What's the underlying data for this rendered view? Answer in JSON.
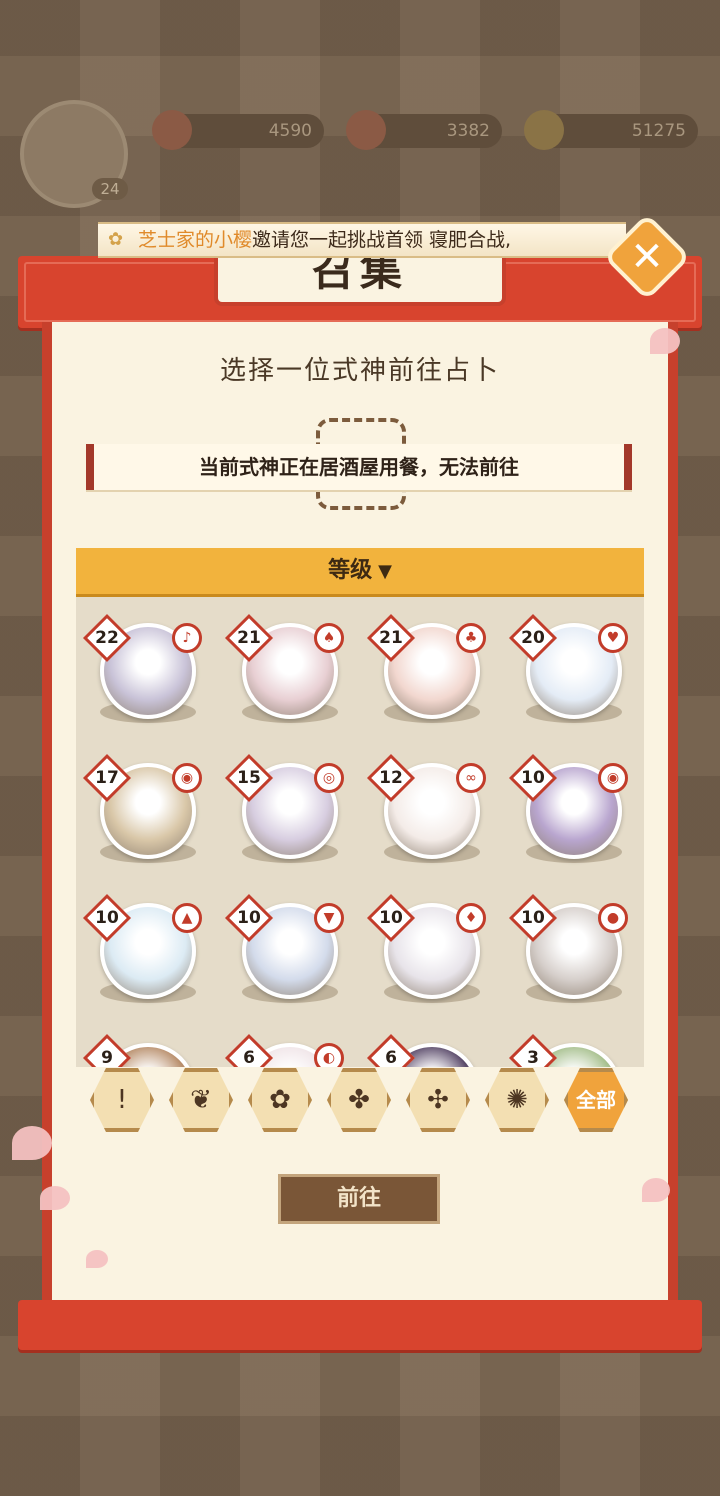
{
  "top": {
    "player_level": "24",
    "resources": [
      "4590",
      "3382",
      "51275"
    ]
  },
  "invite": {
    "inviter": "芝士家的小樱",
    "message": "邀请您一起挑战首领 寝肥合战,"
  },
  "dialog": {
    "title": "召集",
    "subtitle": "选择一位式神前往占卜",
    "notice": "当前式神正在居酒屋用餐，无法前往",
    "close_icon": "✕"
  },
  "sort": {
    "label": "等级",
    "chevron": "▼"
  },
  "shikigami": [
    {
      "level": "22",
      "badge": "♪",
      "color": "#c9c3d8"
    },
    {
      "level": "21",
      "badge": "♠",
      "color": "#e8cfd3"
    },
    {
      "level": "21",
      "badge": "♣",
      "color": "#f2d7cf"
    },
    {
      "level": "20",
      "badge": "♥",
      "color": "#e4ecf6"
    },
    {
      "level": "17",
      "badge": "◉",
      "color": "#d9c7a8"
    },
    {
      "level": "15",
      "badge": "◎",
      "color": "#d7cde0"
    },
    {
      "level": "12",
      "badge": "∞",
      "color": "#f4ece8"
    },
    {
      "level": "10",
      "badge": "◉",
      "color": "#b9a6cf"
    },
    {
      "level": "10",
      "badge": "▲",
      "color": "#dcebf4"
    },
    {
      "level": "10",
      "badge": "▼",
      "color": "#d3dbeb"
    },
    {
      "level": "10",
      "badge": "♦",
      "color": "#e8e4ea"
    },
    {
      "level": "10",
      "badge": "●",
      "color": "#d6cfcb"
    },
    {
      "level": "9",
      "badge": "",
      "color": "#b88e6b"
    },
    {
      "level": "6",
      "badge": "◐",
      "color": "#f0e5e8"
    },
    {
      "level": "6",
      "badge": "",
      "color": "#5a4a6a"
    },
    {
      "level": "3",
      "badge": "",
      "color": "#a7c08e"
    }
  ],
  "filters": [
    "!",
    "❦",
    "✿",
    "✤",
    "✣",
    "✺",
    "全部"
  ],
  "go_button": "前往"
}
